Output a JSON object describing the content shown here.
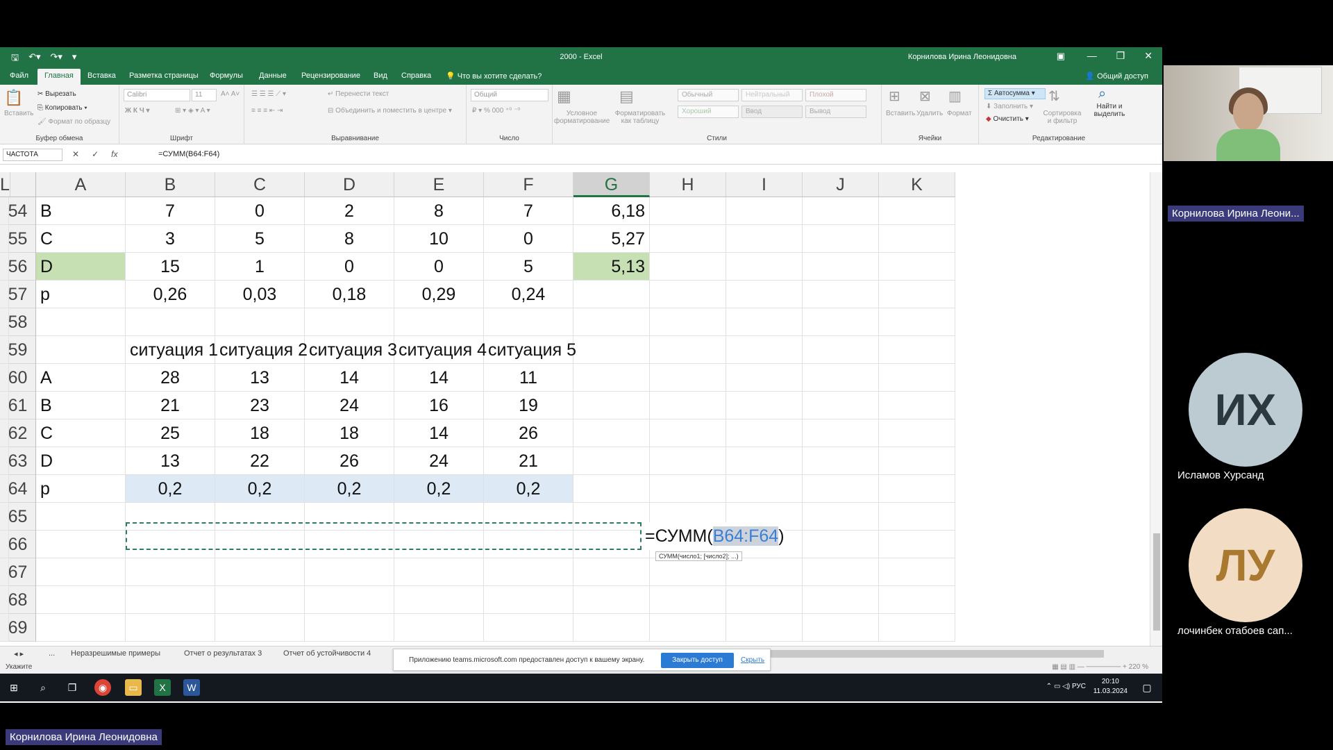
{
  "excel": {
    "title": "2000  -  Excel",
    "user": "Корнилова Ирина Леонидовна",
    "tabs": [
      "Файл",
      "Главная",
      "Вставка",
      "Разметка страницы",
      "Формулы",
      "Данные",
      "Рецензирование",
      "Вид",
      "Справка"
    ],
    "tell_me": "Что вы хотите сделать?",
    "share": "Общий доступ",
    "ribbon": {
      "clipboard": {
        "paste": "Вставить",
        "cut": "Вырезать",
        "copy": "Копировать",
        "format_painter": "Формат по образцу",
        "label": "Буфер обмена"
      },
      "font": {
        "name": "Calibri",
        "size": "11",
        "label": "Шрифт"
      },
      "alignment": {
        "wrap": "Перенести текст",
        "merge": "Объединить и поместить в центре",
        "label": "Выравнивание"
      },
      "number": {
        "format": "Общий",
        "label": "Число"
      },
      "styles": {
        "cond": "Условное форматирование",
        "table": "Форматировать как таблицу",
        "normal": "Обычный",
        "neutral": "Нейтральный",
        "bad": "Плохой",
        "good": "Хороший",
        "input": "Ввод",
        "output": "Вывод",
        "label": "Стили"
      },
      "cells": {
        "insert": "Вставить",
        "delete": "Удалить",
        "format": "Формат",
        "label": "Ячейки"
      },
      "editing": {
        "autosum": "Автосумма",
        "fill": "Заполнить",
        "clear": "Очистить",
        "sort": "Сортировка и фильтр",
        "find": "Найти и выделить",
        "label": "Редактирование"
      }
    },
    "namebox": "ЧАСТОТА",
    "formula": "=СУММ(B64:F64)",
    "columns": [
      "A",
      "B",
      "C",
      "D",
      "E",
      "F",
      "G",
      "H",
      "I",
      "J",
      "K",
      "L"
    ],
    "rows": [
      {
        "num": "54",
        "cells": [
          "B",
          "7",
          "0",
          "2",
          "8",
          "7",
          "6,18"
        ]
      },
      {
        "num": "55",
        "cells": [
          "C",
          "3",
          "5",
          "8",
          "10",
          "0",
          "5,27"
        ]
      },
      {
        "num": "56",
        "cells": [
          "D",
          "15",
          "1",
          "0",
          "0",
          "5",
          "5,13"
        ]
      },
      {
        "num": "57",
        "cells": [
          "p",
          "0,26",
          "0,03",
          "0,18",
          "0,29",
          "0,24",
          ""
        ]
      },
      {
        "num": "58",
        "cells": [
          "",
          "",
          "",
          "",
          "",
          "",
          ""
        ]
      },
      {
        "num": "59",
        "cells": [
          "",
          "ситуация 1",
          "ситуация 2",
          "ситуация 3",
          "ситуация 4",
          "ситуация 5",
          ""
        ]
      },
      {
        "num": "60",
        "cells": [
          "A",
          "28",
          "13",
          "14",
          "14",
          "11",
          ""
        ]
      },
      {
        "num": "61",
        "cells": [
          "B",
          "21",
          "23",
          "24",
          "16",
          "19",
          ""
        ]
      },
      {
        "num": "62",
        "cells": [
          "C",
          "25",
          "18",
          "18",
          "14",
          "26",
          ""
        ]
      },
      {
        "num": "63",
        "cells": [
          "D",
          "13",
          "22",
          "26",
          "24",
          "21",
          ""
        ]
      },
      {
        "num": "64",
        "cells": [
          "p",
          "0,2",
          "0,2",
          "0,2",
          "0,2",
          "0,2",
          ""
        ]
      },
      {
        "num": "65",
        "cells": [
          "",
          "",
          "",
          "",
          "",
          "",
          ""
        ]
      },
      {
        "num": "66",
        "cells": [
          "",
          "",
          "",
          "",
          "",
          "",
          ""
        ]
      },
      {
        "num": "67",
        "cells": [
          "",
          "",
          "",
          "",
          "",
          "",
          ""
        ]
      },
      {
        "num": "68",
        "cells": [
          "",
          "",
          "",
          "",
          "",
          "",
          ""
        ]
      },
      {
        "num": "69",
        "cells": [
          "",
          "",
          "",
          "",
          "",
          "",
          ""
        ]
      }
    ],
    "edit_cell": {
      "prefix": "=СУММ(",
      "ref": "B64:F64",
      "suffix": ")"
    },
    "tooltip": "СУММ(число1; [число2]; ...)",
    "sheet_tabs": [
      "...",
      "Неразрешимые примеры",
      "Отчет о результатах 3",
      "Отчет об устойчивости 4"
    ],
    "status": "Укажите",
    "zoom": "220 %"
  },
  "teams_banner": {
    "message": "Приложению teams.microsoft.com предоставлен доступ к вашему экрану.",
    "stop": "Закрыть доступ",
    "hide": "Скрыть"
  },
  "taskbar": {
    "lang": "РУС",
    "time": "20:10",
    "date": "11.03.2024"
  },
  "participants": {
    "presenter": "Корнилова Ирина Леони...",
    "p1_initials": "ИХ",
    "p1_name": "Исламов Хурсанд",
    "p2_initials": "ЛУ",
    "p2_name": "лочинбек отабоев сап...",
    "bottom_name": "Корнилова Ирина Леонидовна"
  },
  "colors": {
    "excel_green": "#217346",
    "selected_green": "#c6e0b4",
    "teams_purple": "#3b3a7a"
  }
}
